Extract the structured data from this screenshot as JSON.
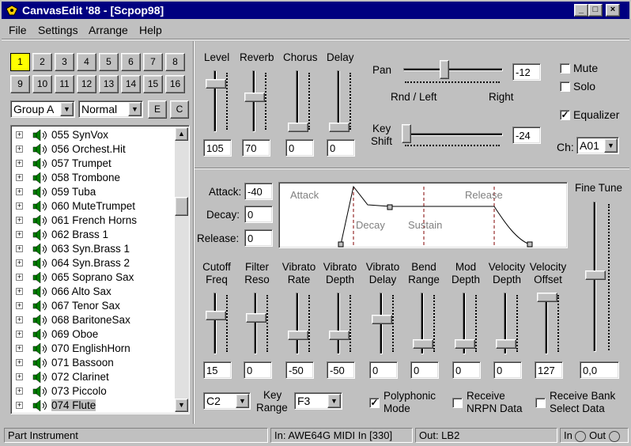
{
  "window": {
    "title": "CanvasEdit '88 - [Scpop98]",
    "min": "_",
    "max": "□",
    "close": "×"
  },
  "menu": {
    "file": "File",
    "settings": "Settings",
    "arrange": "Arrange",
    "help": "Help"
  },
  "parts": {
    "row1": [
      "1",
      "2",
      "3",
      "4",
      "5",
      "6",
      "7",
      "8"
    ],
    "row2": [
      "9",
      "10",
      "11",
      "12",
      "13",
      "14",
      "15",
      "16"
    ],
    "active": "1"
  },
  "group_select": "Group A",
  "mode_select": "Normal",
  "e_button": "E",
  "c_button": "C",
  "instruments": [
    "055 SynVox",
    "056 Orchest.Hit",
    "057 Trumpet",
    "058 Trombone",
    "059 Tuba",
    "060 MuteTrumpet",
    "061 French Horns",
    "062 Brass 1",
    "063 Syn.Brass 1",
    "064 Syn.Brass 2",
    "065 Soprano Sax",
    "066 Alto Sax",
    "067 Tenor Sax",
    "068 BaritoneSax",
    "069 Oboe",
    "070 EnglishHorn",
    "071 Bassoon",
    "072 Clarinet",
    "073 Piccolo",
    "074 Flute"
  ],
  "selected_instrument": "074 Flute",
  "mix": {
    "level": {
      "label": "Level",
      "value": "105"
    },
    "reverb": {
      "label": "Reverb",
      "value": "70"
    },
    "chorus": {
      "label": "Chorus",
      "value": "0"
    },
    "delay": {
      "label": "Delay",
      "value": "0"
    }
  },
  "pan": {
    "label": "Pan",
    "value": "-12",
    "left_label": "Rnd / Left",
    "right_label": "Right"
  },
  "keyshift": {
    "label1": "Key",
    "label2": "Shift",
    "value": "-24"
  },
  "mute": {
    "label": "Mute",
    "checked": false
  },
  "solo": {
    "label": "Solo",
    "checked": false
  },
  "equalizer": {
    "label": "Equalizer",
    "checked": true
  },
  "channel": {
    "label": "Ch:",
    "value": "A01"
  },
  "envelope": {
    "attack_label": "Attack:",
    "attack_value": "-40",
    "decay_label": "Decay:",
    "decay_value": "0",
    "release_label": "Release:",
    "release_value": "0",
    "graph_attack": "Attack",
    "graph_decay": "Decay",
    "graph_sustain": "Sustain",
    "graph_release": "Release"
  },
  "fine_tune": {
    "label": "Fine Tune",
    "value": "0,0"
  },
  "params": [
    {
      "l1": "Cutoff",
      "l2": "Freq",
      "value": "15"
    },
    {
      "l1": "Filter",
      "l2": "Reso",
      "value": "0"
    },
    {
      "l1": "Vibrato",
      "l2": "Rate",
      "value": "-50"
    },
    {
      "l1": "Vibrato",
      "l2": "Depth",
      "value": "-50"
    },
    {
      "l1": "Vibrato",
      "l2": "Delay",
      "value": "0"
    },
    {
      "l1": "Bend",
      "l2": "Range",
      "value": "0"
    },
    {
      "l1": "Mod",
      "l2": "Depth",
      "value": "0"
    },
    {
      "l1": "Velocity",
      "l2": "Depth",
      "value": "0"
    },
    {
      "l1": "Velocity",
      "l2": "Offset",
      "value": "127"
    }
  ],
  "key_range": {
    "label1": "Key",
    "label2": "Range",
    "low": "C2",
    "high": "F3"
  },
  "polyphonic": {
    "label1": "Polyphonic",
    "label2": "Mode",
    "checked": true
  },
  "receive_nrpn": {
    "label1": "Receive",
    "label2": "NRPN Data",
    "checked": false
  },
  "receive_bank": {
    "label1": "Receive Bank",
    "label2": "Select Data",
    "checked": false
  },
  "status": {
    "part": "Part Instrument",
    "in": "In: AWE64G MIDI In [330]",
    "out": "Out: LB2",
    "in_led": "In",
    "out_led": "Out"
  }
}
